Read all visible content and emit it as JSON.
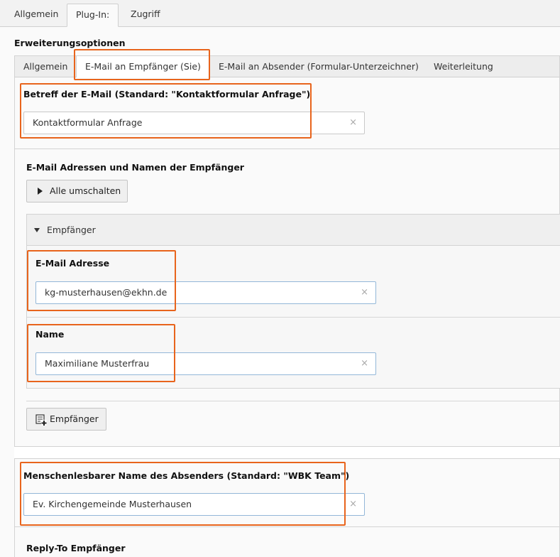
{
  "top_tabs": [
    "Allgemein",
    "Plug-In:",
    "Zugriff"
  ],
  "section_title": "Erweiterungsoptionen",
  "sub_tabs": [
    "Allgemein",
    "E-Mail an Empfänger (Sie)",
    "E-Mail an Absender (Formular-Unterzeichner)",
    "Weiterleitung"
  ],
  "subject": {
    "label": "Betreff der E-Mail (Standard: \"Kontaktformular Anfrage\")",
    "value": "Kontaktformular Anfrage"
  },
  "recipients": {
    "heading": "E-Mail Adressen und Namen der Empfänger",
    "toggle_all_label": "Alle umschalten",
    "item_header": "Empfänger",
    "email_label": "E-Mail Adresse",
    "email_value": "kg-musterhausen@ekhn.de",
    "name_label": "Name",
    "name_value": "Maximiliane Musterfrau",
    "add_button_label": "Empfänger"
  },
  "sender": {
    "label": "Menschenlesbarer Name des Absenders (Standard: \"WBK Team\")",
    "value": "Ev. Kirchengemeinde Musterhausen"
  },
  "reply_to": {
    "label": "Reply-To Empfänger"
  },
  "icons": {
    "clear": "×",
    "toggle": "caret-right-icon",
    "expand": "caret-down-icon",
    "add": "add-record-icon"
  },
  "colors": {
    "highlight": "#e8641c",
    "focus_border": "#93b7d8"
  }
}
